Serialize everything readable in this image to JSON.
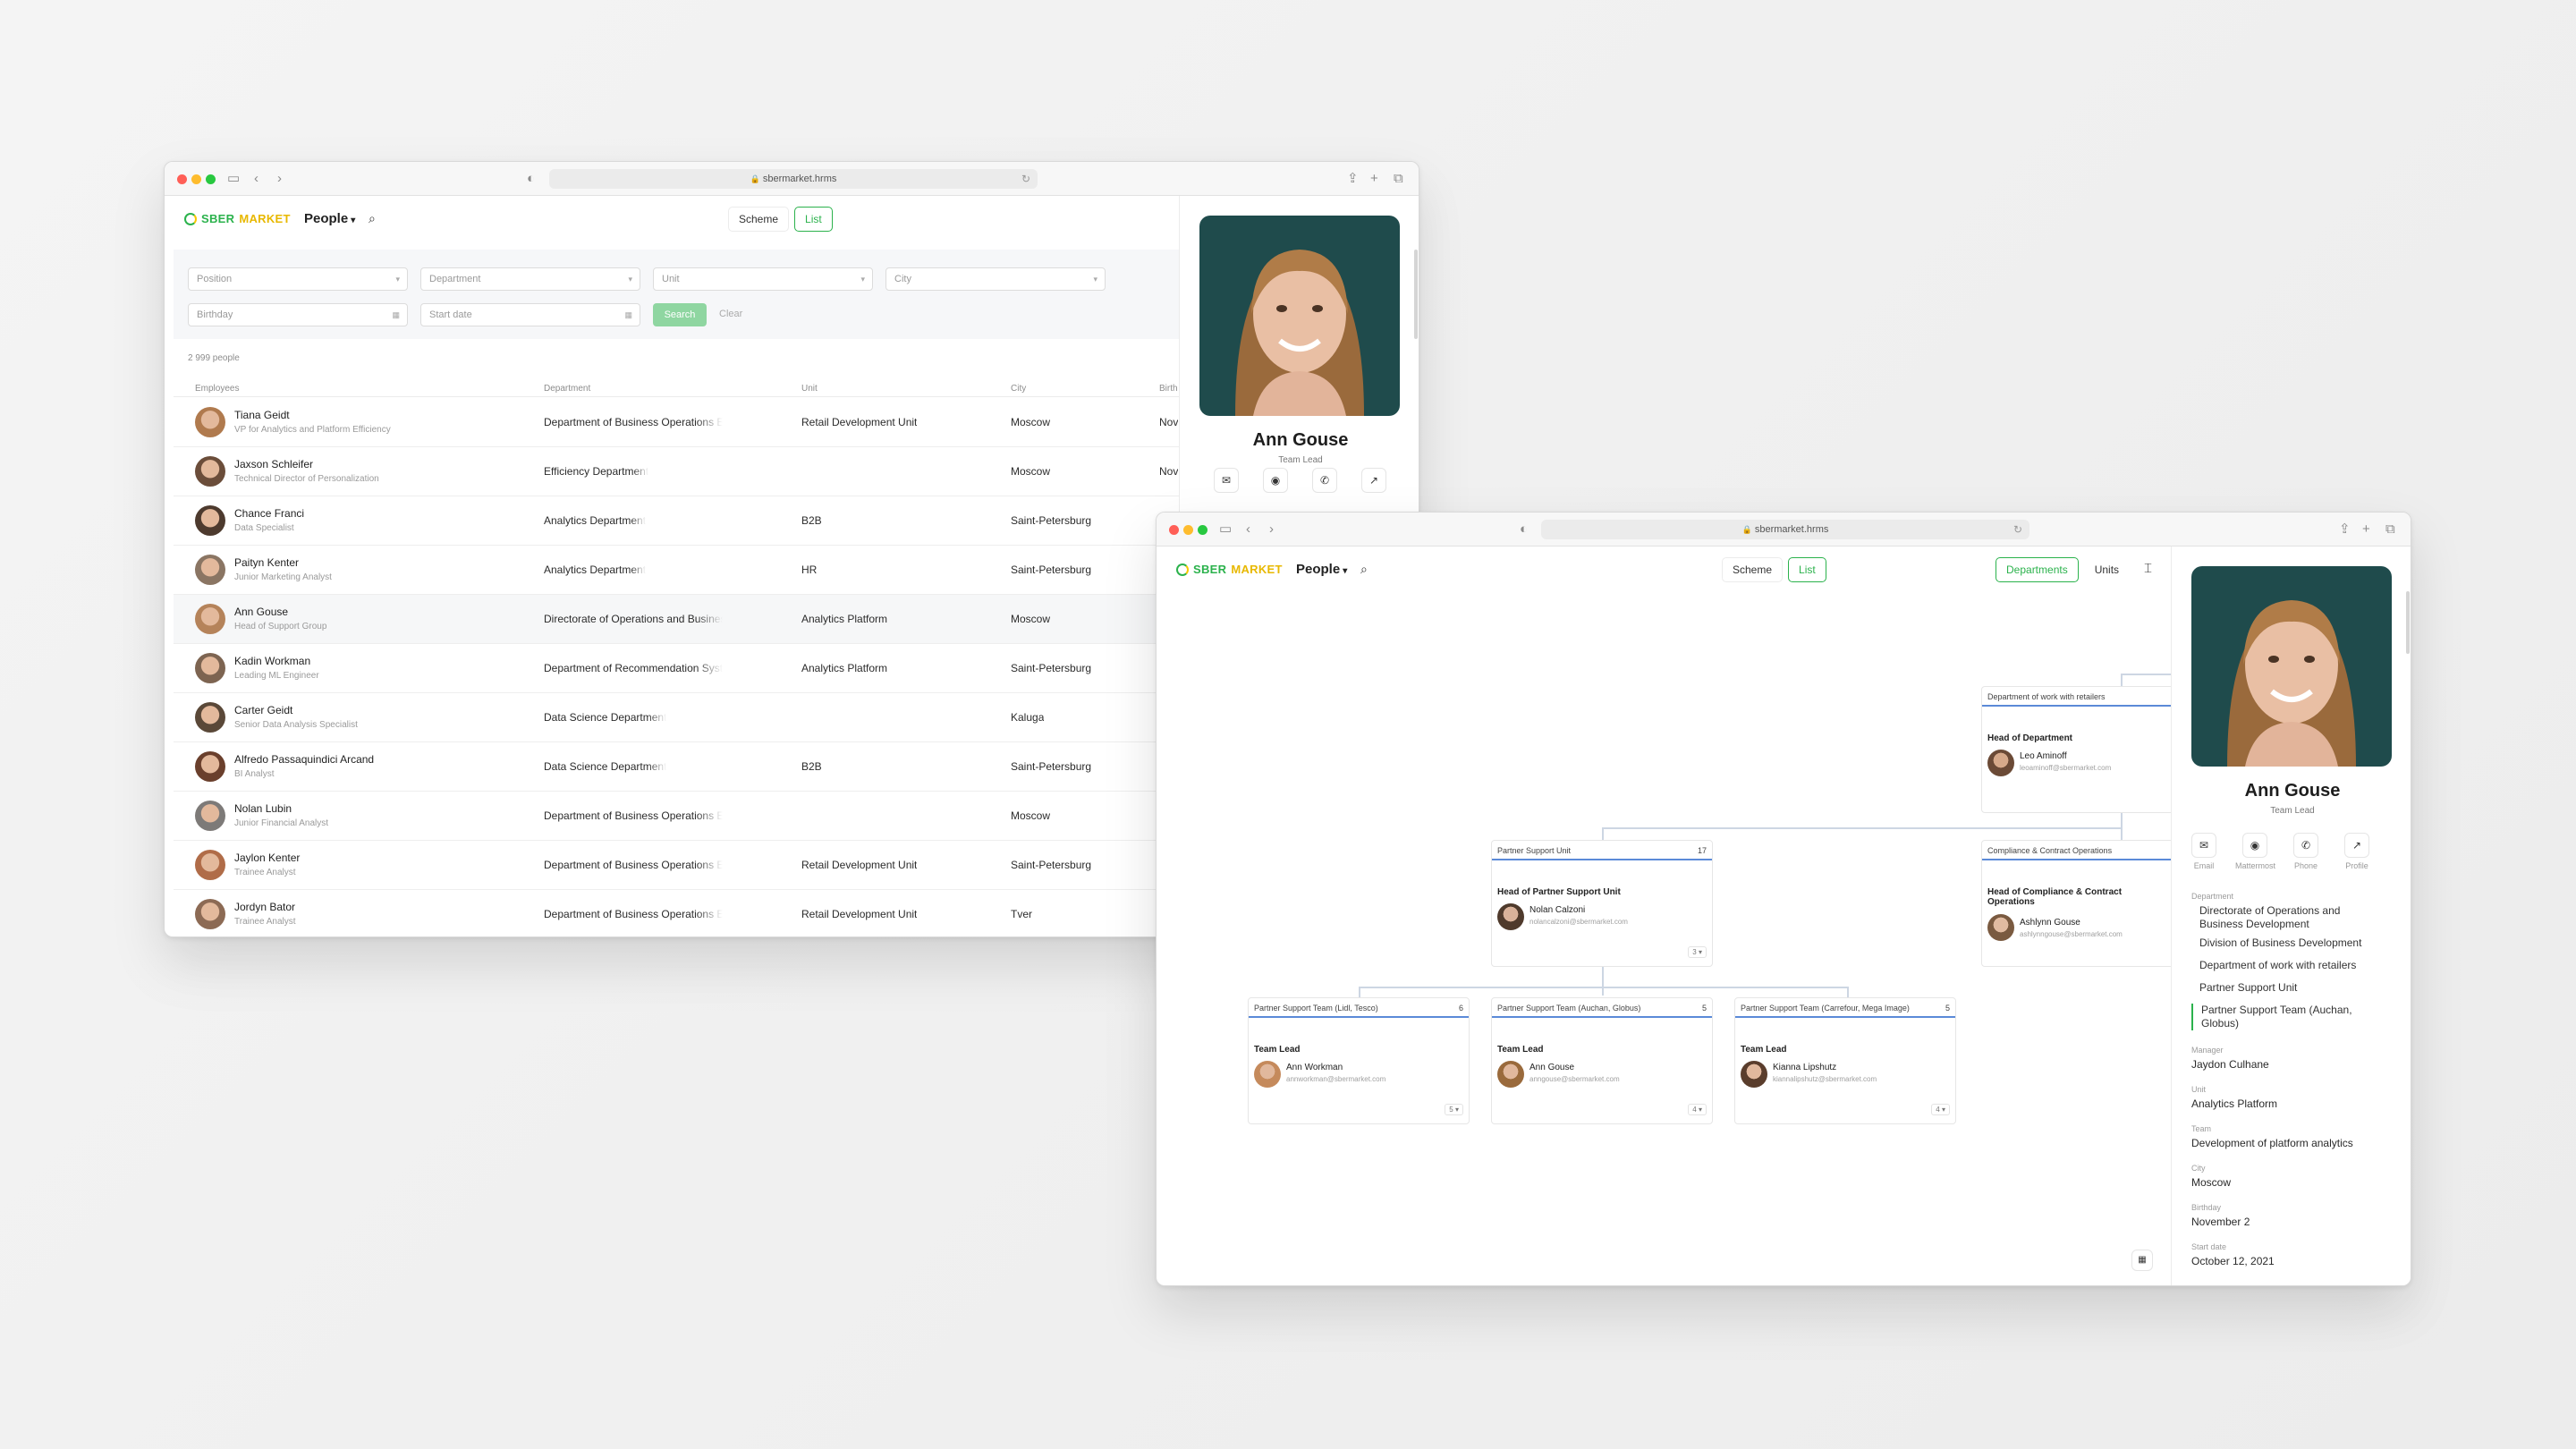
{
  "browser": {
    "url": "sbermarket.hrms"
  },
  "app": {
    "logo_part1": "SBER",
    "logo_part2": "MARKET",
    "section": "People",
    "views": [
      "Scheme",
      "List"
    ],
    "active_view": "List"
  },
  "filters": {
    "position": "Position",
    "department": "Department",
    "unit": "Unit",
    "city": "City",
    "birthday": "Birthday",
    "start_date": "Start date",
    "search": "Search",
    "clear": "Clear"
  },
  "list": {
    "count": "2 999 people",
    "columns": [
      "Employees",
      "Department",
      "Unit",
      "City",
      "Birth"
    ],
    "rows": [
      {
        "name": "Tiana Geidt",
        "position": "VP for Analytics and Platform Efficiency",
        "department": "Department of Business Operations Efficiency",
        "unit": "Retail Development Unit",
        "city": "Moscow",
        "birth": "Nov"
      },
      {
        "name": "Jaxson Schleifer",
        "position": "Technical Director of Personalization",
        "department": "Efficiency Department",
        "unit": "",
        "city": "Moscow",
        "birth": "Nov"
      },
      {
        "name": "Chance Franci",
        "position": "Data Specialist",
        "department": "Analytics Department",
        "unit": "B2B",
        "city": "Saint-Petersburg",
        "birth": ""
      },
      {
        "name": "Paityn Kenter",
        "position": "Junior Marketing Analyst",
        "department": "Analytics Department",
        "unit": "HR",
        "city": "Saint-Petersburg",
        "birth": ""
      },
      {
        "name": "Ann Gouse",
        "position": "Head of Support Group",
        "department": "Directorate of Operations and Business Development",
        "unit": "Analytics Platform",
        "city": "Moscow",
        "birth": ""
      },
      {
        "name": "Kadin Workman",
        "position": "Leading ML Engineer",
        "department": "Department of Recommendation Systems",
        "unit": "Analytics Platform",
        "city": "Saint-Petersburg",
        "birth": ""
      },
      {
        "name": "Carter Geidt",
        "position": "Senior Data Analysis Specialist",
        "department": "Data Science Department",
        "unit": "",
        "city": "Kaluga",
        "birth": ""
      },
      {
        "name": "Alfredo Passaquindici Arcand",
        "position": "BI Analyst",
        "department": "Data Science Department",
        "unit": "B2B",
        "city": "Saint-Petersburg",
        "birth": ""
      },
      {
        "name": "Nolan Lubin",
        "position": "Junior Financial Analyst",
        "department": "Department of Business Operations Efficiency",
        "unit": "",
        "city": "Moscow",
        "birth": ""
      },
      {
        "name": "Jaylon Kenter",
        "position": "Trainee Analyst",
        "department": "Department of Business Operations Efficiency",
        "unit": "Retail Development Unit",
        "city": "Saint-Petersburg",
        "birth": ""
      },
      {
        "name": "Jordyn Bator",
        "position": "Trainee Analyst",
        "department": "Department of Business Operations Efficiency",
        "unit": "Retail Development Unit",
        "city": "Tver",
        "birth": ""
      }
    ]
  },
  "profile": {
    "name": "Ann Gouse",
    "role": "Team Lead",
    "actions": [
      "Email",
      "Mattermost",
      "Phone",
      "Profile"
    ],
    "department_label": "Department",
    "departments": [
      "Directorate of Operations and Business Development",
      "Division of Business Development",
      "Department of work with retailers",
      "Partner Support Unit",
      "Partner Support Team (Auchan, Globus)"
    ],
    "manager_label": "Manager",
    "manager": "Jaydon Culhane",
    "unit_label": "Unit",
    "unit": "Analytics Platform",
    "team_label": "Team",
    "team": "Development of platform analytics",
    "city_label": "City",
    "city": "Moscow",
    "birthday_label": "Birthday",
    "birthday": "November 2",
    "start_label": "Start date",
    "start": "October 12, 2021"
  },
  "scheme": {
    "toggles": [
      "Departments",
      "Units"
    ],
    "retail": {
      "title": "Department of work with retailers",
      "role": "Head of Department",
      "name": "Leo Aminoff",
      "email": "leoaminoff@sbermarket.com"
    },
    "partner": {
      "title": "Partner Support Unit",
      "count": "17",
      "role": "Head of Partner Support Unit",
      "name": "Nolan Calzoni",
      "email": "nolancalzoni@sbermarket.com",
      "sub": "3"
    },
    "compliance": {
      "title": "Compliance & Contract Operations",
      "role": "Head of Compliance & Contract Operations",
      "name": "Ashlynn Gouse",
      "email": "ashlynngouse@sbermarket.com"
    },
    "teams": [
      {
        "title": "Partner Support Team (Lidl, Tesco)",
        "count": "6",
        "role": "Team Lead",
        "name": "Ann Workman",
        "email": "annworkman@sbermarket.com",
        "sub": "5"
      },
      {
        "title": "Partner Support Team (Auchan, Globus)",
        "count": "5",
        "role": "Team Lead",
        "name": "Ann Gouse",
        "email": "anngouse@sbermarket.com",
        "sub": "4"
      },
      {
        "title": "Partner Support Team (Carrefour, Mega Image)",
        "count": "5",
        "role": "Team Lead",
        "name": "Kianna Lipshutz",
        "email": "kiannalipshutz@sbermarket.com",
        "sub": "4"
      }
    ]
  }
}
